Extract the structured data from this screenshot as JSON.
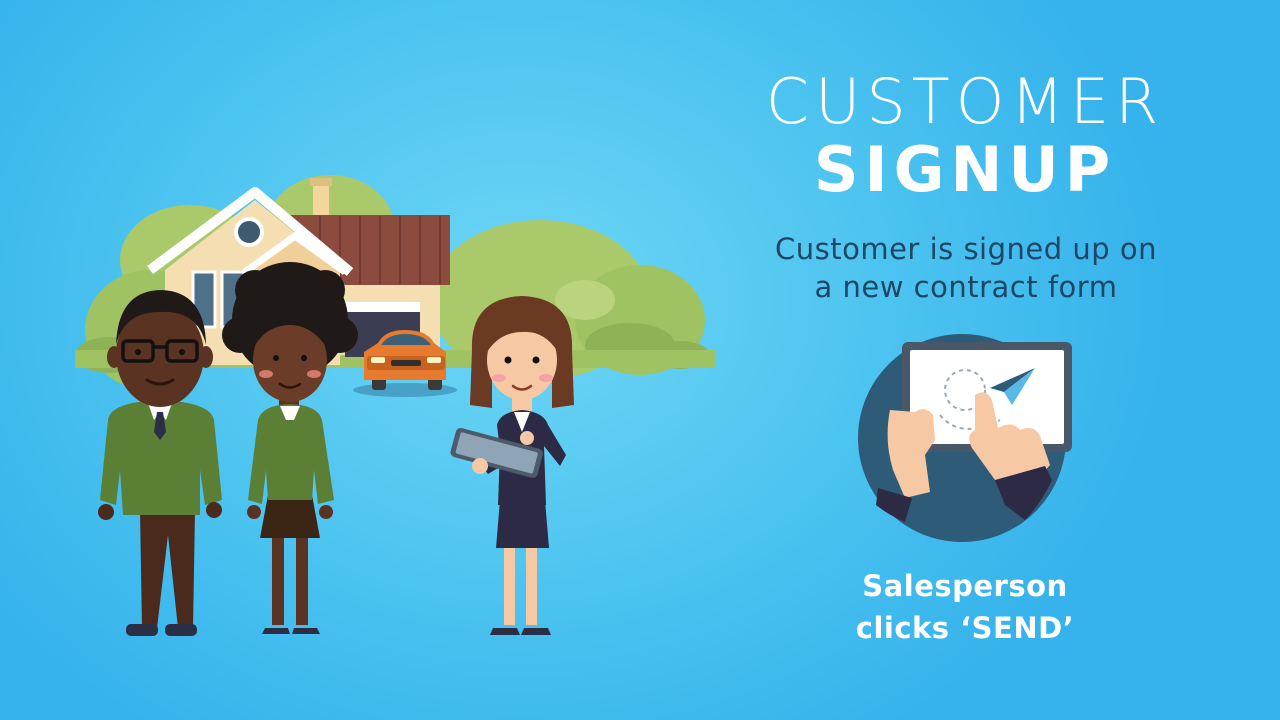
{
  "title": {
    "line1": "CUSTOMER",
    "line2": "SIGNUP"
  },
  "description": {
    "line1": "Customer is signed up on",
    "line2": "a new contract form"
  },
  "caption": {
    "line1": "Salesperson",
    "line2": "clicks ‘SEND’"
  },
  "colors": {
    "background": "#4dc4f0",
    "description_text": "#1f4764",
    "headline_text": "#ffffff",
    "shrubs": "#a9c96a",
    "roof": "#8b4b3d",
    "house_wall": "#f5deb2",
    "car": "#e67a2e",
    "sweater": "#5a7f35",
    "suit": "#2c2a45",
    "circle_badge": "#2e5b78"
  },
  "icons": [
    "house-illustration",
    "car-illustration",
    "tablet-send-icon",
    "paper-plane-icon"
  ]
}
